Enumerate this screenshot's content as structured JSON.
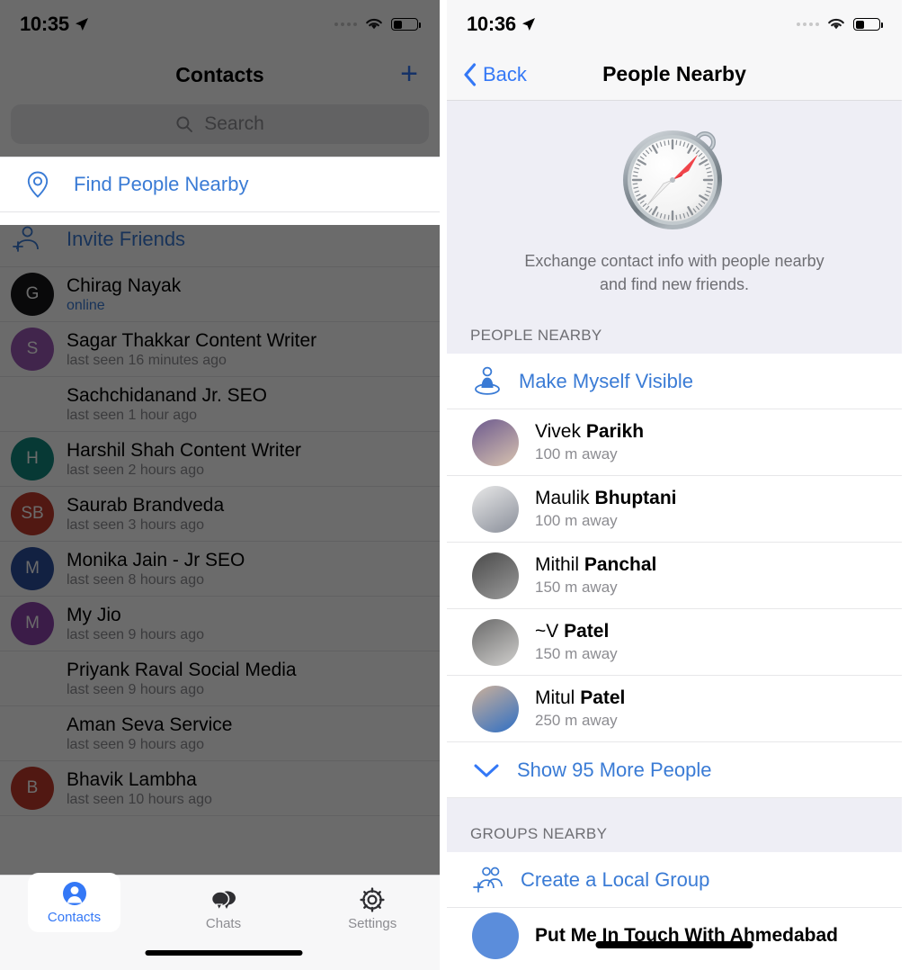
{
  "left": {
    "status": {
      "time": "10:35",
      "location_icon": "location-arrow-icon",
      "wifi_icon": "wifi-icon",
      "battery_icon": "battery-icon"
    },
    "nav": {
      "title": "Contacts",
      "add_label": "+"
    },
    "search": {
      "placeholder": "Search",
      "icon": "search-icon"
    },
    "find_people": {
      "label": "Find People Nearby",
      "icon": "location-pin-icon"
    },
    "invite": {
      "label": "Invite Friends",
      "icon": "add-person-icon"
    },
    "contacts": [
      {
        "name": "Chirag Nayak",
        "status": "online",
        "online": true,
        "initials": "G",
        "color": "#17171a"
      },
      {
        "name": "Sagar Thakkar Content Writer",
        "status": "last seen 16 minutes ago",
        "online": false,
        "initials": "S",
        "color": "#9b59b6"
      },
      {
        "name": "Sachchidanand Jr. SEO",
        "status": "last seen 1 hour ago",
        "online": false,
        "initials": "",
        "color": "transparent"
      },
      {
        "name": "Harshil Shah Content Writer",
        "status": "last seen 2 hours ago",
        "online": false,
        "initials": "H",
        "color": "#12887f"
      },
      {
        "name": "Saurab Brandveda",
        "status": "last seen 3 hours ago",
        "online": false,
        "initials": "SB",
        "color": "#c0392b"
      },
      {
        "name": "Monika Jain - Jr SEO",
        "status": "last seen 8 hours ago",
        "online": false,
        "initials": "M",
        "color": "#2b4f9e"
      },
      {
        "name": "My Jio",
        "status": "last seen 9 hours ago",
        "online": false,
        "initials": "M",
        "color": "#8e44ad"
      },
      {
        "name": "Priyank Raval Social Media",
        "status": "last seen 9 hours ago",
        "online": false,
        "initials": "",
        "color": "transparent"
      },
      {
        "name": "Aman Seva Service",
        "status": "last seen 9 hours ago",
        "online": false,
        "initials": "",
        "color": "transparent"
      },
      {
        "name": "Bhavik Lambha",
        "status": "last seen 10 hours ago",
        "online": false,
        "initials": "B",
        "color": "#c0392b"
      }
    ],
    "tabs": [
      {
        "label": "Contacts",
        "icon": "person-icon",
        "active": true
      },
      {
        "label": "Chats",
        "icon": "chat-bubbles-icon",
        "active": false
      },
      {
        "label": "Settings",
        "icon": "gear-icon",
        "active": false
      }
    ]
  },
  "right": {
    "status": {
      "time": "10:36",
      "location_icon": "location-arrow-icon",
      "wifi_icon": "wifi-icon",
      "battery_icon": "battery-icon"
    },
    "nav": {
      "back_label": "Back",
      "title": "People Nearby",
      "back_icon": "chevron-left-icon"
    },
    "hero": {
      "icon": "compass-icon",
      "description_line1": "Exchange contact info with people nearby",
      "description_line2": "and find new friends."
    },
    "people_section": {
      "header": "PEOPLE NEARBY",
      "make_visible": {
        "label": "Make Myself Visible",
        "icon": "person-on-platform-icon"
      },
      "people": [
        {
          "first": "Vivek",
          "last": "Parikh",
          "distance": "100 m away"
        },
        {
          "first": "Maulik",
          "last": "Bhuptani",
          "distance": "100 m away"
        },
        {
          "first": "Mithil",
          "last": "Panchal",
          "distance": "150 m away"
        },
        {
          "first": "~V",
          "last": "Patel",
          "distance": "150 m away"
        },
        {
          "first": "Mitul",
          "last": "Patel",
          "distance": "250 m away"
        }
      ],
      "show_more": {
        "label": "Show 95 More People",
        "icon": "chevron-down-icon"
      }
    },
    "groups_section": {
      "header": "GROUPS NEARBY",
      "create_group": {
        "label": "Create a Local Group",
        "icon": "add-group-icon"
      },
      "first_group": "Put Me In Touch With Ahmedabad"
    }
  },
  "colors": {
    "accent": "#3478f6",
    "link": "#3a7bd5",
    "section_bg": "#eeeef5",
    "muted": "#8c8c91"
  }
}
